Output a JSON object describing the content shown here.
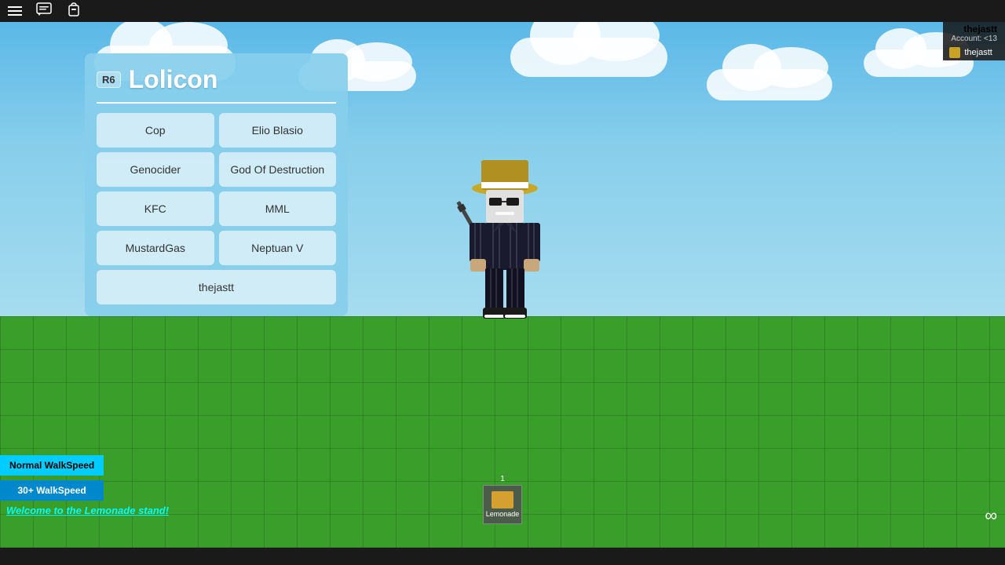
{
  "topbar": {
    "icons": [
      "menu",
      "chat",
      "backpack"
    ]
  },
  "account": {
    "username": "thejastt",
    "balance_label": "Account: <13",
    "user_display": "thejastt"
  },
  "admin_panel": {
    "r6_label": "R6",
    "title": "Lolicon",
    "players": [
      {
        "id": "cop",
        "label": "Cop"
      },
      {
        "id": "elio-blasio",
        "label": "Elio Blasio"
      },
      {
        "id": "genocider",
        "label": "Genocider"
      },
      {
        "id": "god-of-destruction",
        "label": "God Of Destruction"
      },
      {
        "id": "kfc",
        "label": "KFC"
      },
      {
        "id": "mml",
        "label": "MML"
      },
      {
        "id": "mustardgas",
        "label": "MustardGas"
      },
      {
        "id": "neptuan-v",
        "label": "Neptuan V"
      },
      {
        "id": "thejastt",
        "label": "thejastt"
      }
    ]
  },
  "buttons": {
    "normal_walkspeed": "Normal WalkSpeed",
    "walkspeed_30": "30+ WalkSpeed"
  },
  "welcome": {
    "text": "Welcome to the Lemonade stand!"
  },
  "hotbar": {
    "slot_number": "1",
    "item_label": "Lemonade"
  },
  "infinity_symbol": "∞"
}
